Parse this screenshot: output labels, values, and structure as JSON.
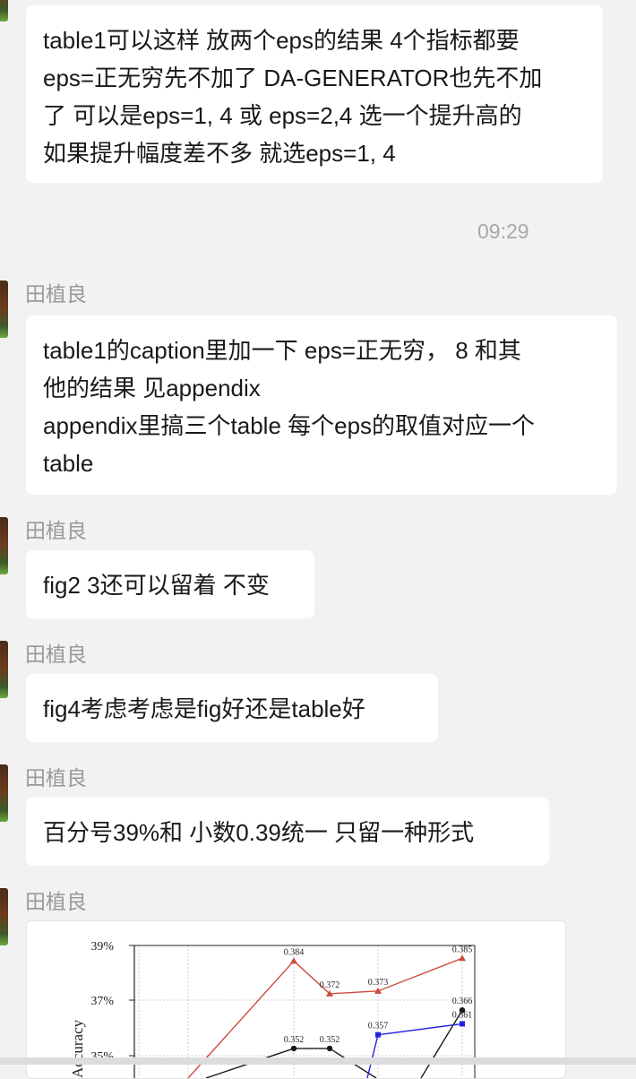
{
  "messages": [
    {
      "text": "table1可以这样 放两个eps的结果 4个指标都要\neps=正无穷先不加了 DA-GENERATOR也先不加\n了   可以是eps=1, 4 或 eps=2,4 选一个提升高的\n如果提升幅度差不多 就选eps=1, 4"
    },
    {
      "sender": "田植良",
      "text": "table1的caption里加一下 eps=正无穷，  8  和其\n他的结果 见appendix\nappendix里搞三个table 每个eps的取值对应一个\n table"
    },
    {
      "sender": "田植良",
      "text": "fig2 3还可以留着 不变"
    },
    {
      "sender": "田植良",
      "text": "fig4考虑考虑是fig好还是table好"
    },
    {
      "sender": "田植良",
      "text": "百分号39%和 小数0.39统一 只留一种形式"
    },
    {
      "sender": "田植良"
    }
  ],
  "timestamp": "09:29",
  "chart_data": {
    "type": "line",
    "ylabel": "Accuracy",
    "yticks": [
      "39%",
      "37%",
      "35%"
    ],
    "series": [
      {
        "color": "#cc4b3c",
        "x": [
          4,
          5,
          6,
          7,
          8
        ],
        "values": [
          0.384,
          0.372,
          0.373,
          null,
          0.385
        ],
        "labels": [
          "0.384",
          "0.372",
          "0.373",
          "",
          "0.385"
        ]
      },
      {
        "color": "#1a1a1a",
        "x": [
          4,
          5,
          8
        ],
        "values": [
          0.352,
          0.352,
          0.366
        ],
        "labels": [
          "0.352",
          "0.352",
          "0.366"
        ]
      },
      {
        "color": "#2222dd",
        "x": [
          6,
          8
        ],
        "values": [
          0.357,
          0.361
        ],
        "labels": [
          "0.357",
          "0.361"
        ]
      }
    ]
  }
}
